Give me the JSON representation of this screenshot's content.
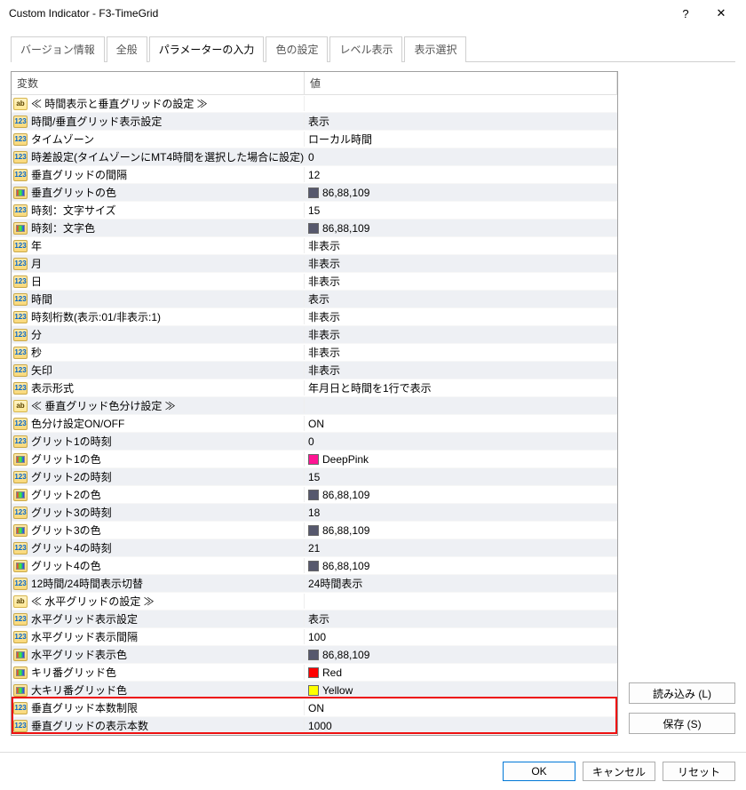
{
  "window": {
    "title": "Custom Indicator - F3-TimeGrid",
    "help": "?",
    "close": "✕"
  },
  "tabs": [
    {
      "label": "バージョン情報"
    },
    {
      "label": "全般"
    },
    {
      "label": "パラメーターの入力",
      "active": true
    },
    {
      "label": "色の設定"
    },
    {
      "label": "レベル表示"
    },
    {
      "label": "表示選択"
    }
  ],
  "grid": {
    "headers": {
      "variable": "変数",
      "value": "値"
    },
    "rows": [
      {
        "icon": "str",
        "name": "≪ 時間表示と垂直グリッドの設定 ≫",
        "value": ""
      },
      {
        "icon": "num",
        "name": "時間/垂直グリッド表示設定",
        "value": "表示"
      },
      {
        "icon": "num",
        "name": "タイムゾーン",
        "value": "ローカル時間"
      },
      {
        "icon": "num",
        "name": "時差設定(タイムゾーンにMT4時間を選択した場合に設定)",
        "value": "0"
      },
      {
        "icon": "num",
        "name": "垂直グリッドの間隔",
        "value": "12"
      },
      {
        "icon": "col",
        "name": "垂直グリットの色",
        "value": "86,88,109",
        "swatch": "#56586d"
      },
      {
        "icon": "num",
        "name": "時刻：文字サイズ",
        "value": "15"
      },
      {
        "icon": "col",
        "name": "時刻：文字色",
        "value": "86,88,109",
        "swatch": "#56586d"
      },
      {
        "icon": "num",
        "name": "年",
        "value": "非表示"
      },
      {
        "icon": "num",
        "name": "月",
        "value": "非表示"
      },
      {
        "icon": "num",
        "name": "日",
        "value": "非表示"
      },
      {
        "icon": "num",
        "name": "時間",
        "value": "表示"
      },
      {
        "icon": "num",
        "name": "時刻桁数(表示:01/非表示:1)",
        "value": "非表示"
      },
      {
        "icon": "num",
        "name": "分",
        "value": "非表示"
      },
      {
        "icon": "num",
        "name": "秒",
        "value": "非表示"
      },
      {
        "icon": "num",
        "name": "矢印",
        "value": "非表示"
      },
      {
        "icon": "num",
        "name": "表示形式",
        "value": "年月日と時間を1行で表示"
      },
      {
        "icon": "str",
        "name": "≪ 垂直グリッド色分け設定 ≫",
        "value": ""
      },
      {
        "icon": "num",
        "name": "色分け設定ON/OFF",
        "value": "ON"
      },
      {
        "icon": "num",
        "name": "グリット1の時刻",
        "value": "0"
      },
      {
        "icon": "col",
        "name": "グリット1の色",
        "value": "DeepPink",
        "swatch": "#ff1493"
      },
      {
        "icon": "num",
        "name": "グリット2の時刻",
        "value": "15"
      },
      {
        "icon": "col",
        "name": "グリット2の色",
        "value": "86,88,109",
        "swatch": "#56586d"
      },
      {
        "icon": "num",
        "name": "グリット3の時刻",
        "value": "18"
      },
      {
        "icon": "col",
        "name": "グリット3の色",
        "value": "86,88,109",
        "swatch": "#56586d"
      },
      {
        "icon": "num",
        "name": "グリット4の時刻",
        "value": "21"
      },
      {
        "icon": "col",
        "name": "グリット4の色",
        "value": "86,88,109",
        "swatch": "#56586d"
      },
      {
        "icon": "num",
        "name": "12時間/24時間表示切替",
        "value": "24時間表示"
      },
      {
        "icon": "str",
        "name": "≪ 水平グリッドの設定 ≫",
        "value": ""
      },
      {
        "icon": "num",
        "name": "水平グリッド表示設定",
        "value": "表示"
      },
      {
        "icon": "num",
        "name": "水平グリッド表示間隔",
        "value": "100"
      },
      {
        "icon": "col",
        "name": "水平グリッド表示色",
        "value": "86,88,109",
        "swatch": "#56586d"
      },
      {
        "icon": "col",
        "name": "キリ番グリッド色",
        "value": "Red",
        "swatch": "#ff0000"
      },
      {
        "icon": "col",
        "name": "大キリ番グリッド色",
        "value": "Yellow",
        "swatch": "#ffff00"
      },
      {
        "icon": "num",
        "name": "垂直グリッド本数制限",
        "value": "ON",
        "highlight": true
      },
      {
        "icon": "num",
        "name": "垂直グリッドの表示本数",
        "value": "1000",
        "highlight": true
      }
    ]
  },
  "side": {
    "load": "読み込み (L)",
    "save": "保存 (S)"
  },
  "footer": {
    "ok": "OK",
    "cancel": "キャンセル",
    "reset": "リセット"
  }
}
